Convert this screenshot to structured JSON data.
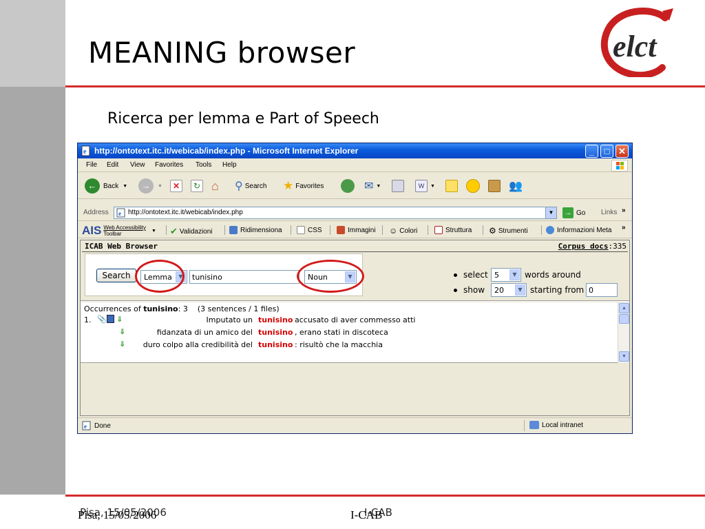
{
  "slide": {
    "title": "MEANING browser",
    "subtitle": "Ricerca per lemma e Part of Speech",
    "logo_text": "elct",
    "footer_date": "Pisa, 15/05/2006",
    "footer_project": "I-CAB",
    "accent_color": "#d42a2a"
  },
  "browser": {
    "window_title": "http://ontotext.itc.it/webicab/index.php - Microsoft Internet Explorer",
    "menu": [
      "File",
      "Edit",
      "View",
      "Favorites",
      "Tools",
      "Help"
    ],
    "toolbar": {
      "back": "Back",
      "search": "Search",
      "favorites": "Favorites"
    },
    "address_label": "Address",
    "address_value": "http://ontotext.itc.it/webicab/index.php",
    "go_label": "Go",
    "links_label": "Links",
    "ais": {
      "brand": "AIS",
      "line1": "Web Accessibility",
      "line2": "Toolbar",
      "items": [
        "Validazioni",
        "Ridimensiona",
        "CSS",
        "Immagini",
        "Colori",
        "Struttura",
        "Strumenti",
        "Informazioni Meta"
      ]
    },
    "status_text": "Done",
    "zone_text": "Local intranet"
  },
  "app": {
    "title": "ICAB Web Browser",
    "corpus_label": "Corpus docs",
    "corpus_count": ":335",
    "search_button": "Search",
    "field_select": "Lemma",
    "query": "tunisino",
    "pos_select": "Noun",
    "select_label": "select",
    "select_value": "5",
    "words_around": "words around",
    "show_label": "show",
    "show_value": "20",
    "starting_from": "starting from",
    "start_value": "0",
    "occ": {
      "prefix": "Occurrences of ",
      "term": "tunisino",
      "count": ": 3",
      "detail": "(3 sentences / 1 files)"
    },
    "rows": [
      {
        "num": "1.",
        "left": "Imputato un",
        "kw": "tunisino",
        "right": "accusato di aver commesso atti"
      },
      {
        "num": "",
        "left": "fidanzata di un amico del",
        "kw": "tunisino",
        "right": ", erano stati in discoteca"
      },
      {
        "num": "",
        "left": "duro colpo alla credibilità del",
        "kw": "tunisino",
        "right": ": risultò che la macchia"
      }
    ]
  }
}
